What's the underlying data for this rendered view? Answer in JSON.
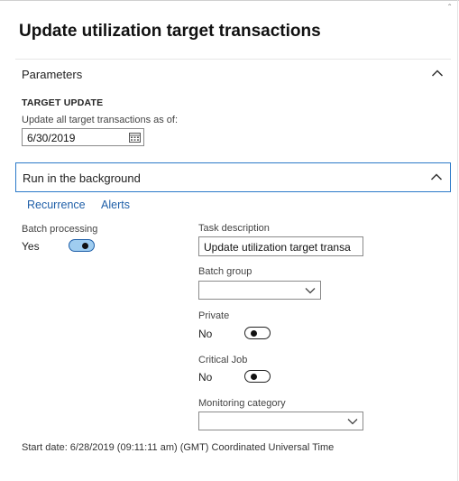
{
  "dialog": {
    "title": "Update utilization target transactions",
    "corner_glyph": "ˆ"
  },
  "parameters": {
    "header": "Parameters",
    "group_title": "TARGET UPDATE",
    "date_label": "Update all target transactions as of:",
    "date_value": "6/30/2019"
  },
  "background": {
    "header": "Run in the background",
    "links": {
      "recurrence": "Recurrence",
      "alerts": "Alerts"
    },
    "batch_processing": {
      "label": "Batch processing",
      "value": "Yes",
      "on": true
    },
    "task_description": {
      "label": "Task description",
      "value": "Update utilization target transa"
    },
    "batch_group": {
      "label": "Batch group",
      "value": ""
    },
    "private": {
      "label": "Private",
      "value": "No",
      "on": false
    },
    "critical_job": {
      "label": "Critical Job",
      "value": "No",
      "on": false
    },
    "monitoring_category": {
      "label": "Monitoring category",
      "value": ""
    },
    "start_date": "Start date: 6/28/2019 (09:11:11 am) (GMT) Coordinated Universal Time"
  },
  "colors": {
    "accent": "#2b79c9",
    "toggle_on": "#9fcdf0",
    "link": "#1f5fa8"
  },
  "icons": [
    "chevron-up-icon",
    "calendar-icon",
    "chevron-down-icon"
  ]
}
